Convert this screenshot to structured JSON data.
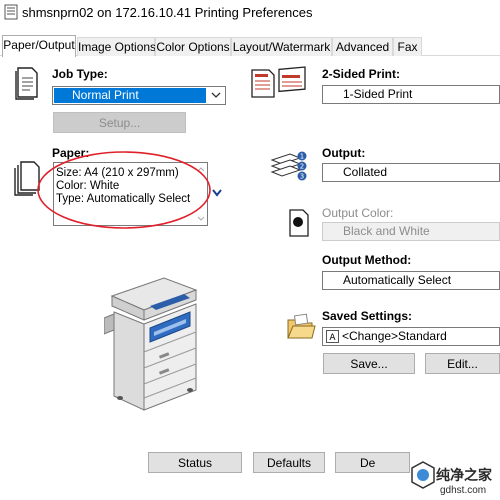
{
  "window": {
    "title": "shmsnprn02 on 172.16.10.41 Printing Preferences"
  },
  "tabs": [
    {
      "label": "Paper/Output"
    },
    {
      "label": "Image Options"
    },
    {
      "label": "Color Options"
    },
    {
      "label": "Layout/Watermark"
    },
    {
      "label": "Advanced"
    },
    {
      "label": "Fax"
    }
  ],
  "job_type": {
    "label": "Job Type:",
    "value": "Normal Print",
    "setup_button": "Setup..."
  },
  "paper": {
    "label": "Paper:",
    "size": "Size: A4 (210 x 297mm)",
    "color": "Color: White",
    "type": "Type: Automatically Select"
  },
  "two_sided": {
    "label": "2-Sided Print:",
    "value": "1-Sided Print"
  },
  "output": {
    "label": "Output:",
    "value": "Collated"
  },
  "output_color": {
    "label": "Output Color:",
    "value": "Black and White"
  },
  "output_method": {
    "label": "Output Method:",
    "value": "Automatically Select"
  },
  "saved_settings": {
    "label": "Saved Settings:",
    "value": "<Change>Standard",
    "save_button": "Save...",
    "edit_button": "Edit..."
  },
  "footer": {
    "status_button": "Status",
    "defaults_button": "Defaults",
    "third_button": "De"
  },
  "watermark": {
    "text": "纯净之家",
    "url": "gdhst.com"
  },
  "colors": {
    "accent": "#0078d7",
    "annotation_red": "#e0202a"
  }
}
